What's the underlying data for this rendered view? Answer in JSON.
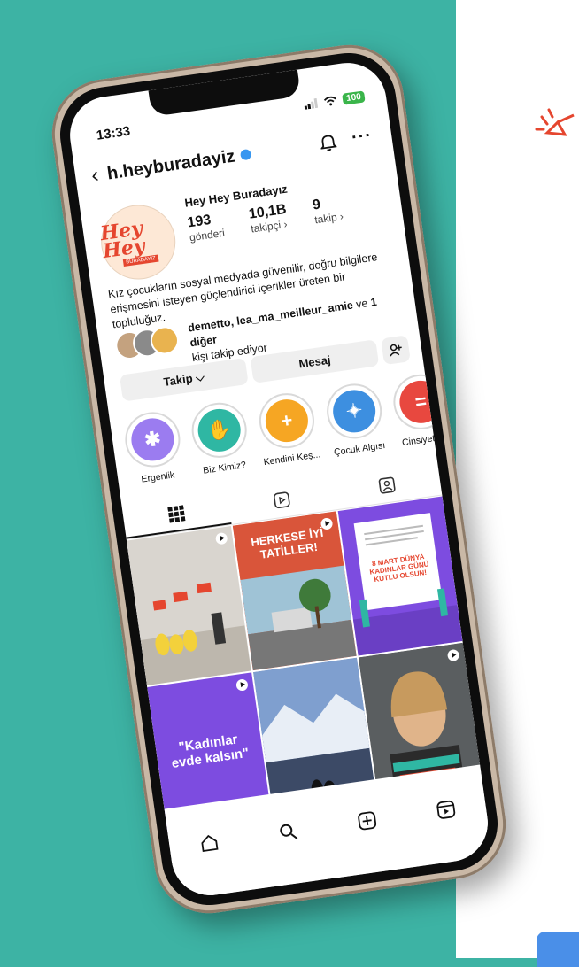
{
  "status_bar": {
    "time": "13:33",
    "battery": "100"
  },
  "header": {
    "username": "h.heyburadayiz",
    "back_icon": "chevron-left-icon",
    "bell_icon": "bell-icon",
    "more_label": "···"
  },
  "profile": {
    "avatar_text": "Hey Hey",
    "avatar_subtext": "BURADAYIZ",
    "display_name": "Hey Hey Buradayız",
    "stats": [
      {
        "value": "193",
        "label": "gönderi"
      },
      {
        "value": "10,1B",
        "label": "takipçi ›"
      },
      {
        "value": "9",
        "label": "takip ›"
      }
    ]
  },
  "bio": "Kız çocukların sosyal medyada güvenilir, doğru bilgilere erişmesini isteyen güçlendirici içerikler üreten bir topluluğuz.",
  "followed_by": {
    "names": "demetto, lea_ma_meilleur_amie",
    "connector": " ve ",
    "others": "1 diğer",
    "suffix": "kişi takip ediyor"
  },
  "actions": {
    "follow": "Takip ⌵",
    "message": "Mesaj",
    "add_person_icon": "add-person-icon"
  },
  "highlights": [
    {
      "label": "Ergenlik",
      "color": "#9b7cf0",
      "symbol": "✱"
    },
    {
      "label": "Biz Kimiz?",
      "color": "#2fb7a3",
      "symbol": "✋"
    },
    {
      "label": "Kendini Keş...",
      "color": "#f6a623",
      "symbol": "+"
    },
    {
      "label": "Çocuk Algısı",
      "color": "#3d8fe0",
      "symbol": "✦"
    },
    {
      "label": "Cinsiyetçilik",
      "color": "#e8483f",
      "symbol": "="
    }
  ],
  "grid_posts": [
    {
      "caption": "",
      "bg": "#d9d5cf"
    },
    {
      "caption": "HERKESE İYİ TATİLLER!",
      "bg": "#d9553a"
    },
    {
      "caption": "8 MART DÜNYA KADINLAR GÜNÜ KUTLU OLSUN!",
      "bg": "#7d4ce0"
    },
    {
      "caption": "\"Kadınlar evde kalsın\"",
      "bg": "#7d4ce0"
    },
    {
      "caption": "",
      "bg": "#6a86b8"
    },
    {
      "caption": "",
      "bg": "#3a3c3e"
    }
  ],
  "colors": {
    "background": "#3db3a4",
    "accent_orange": "#e5462f",
    "purple": "#7d4ce0"
  }
}
